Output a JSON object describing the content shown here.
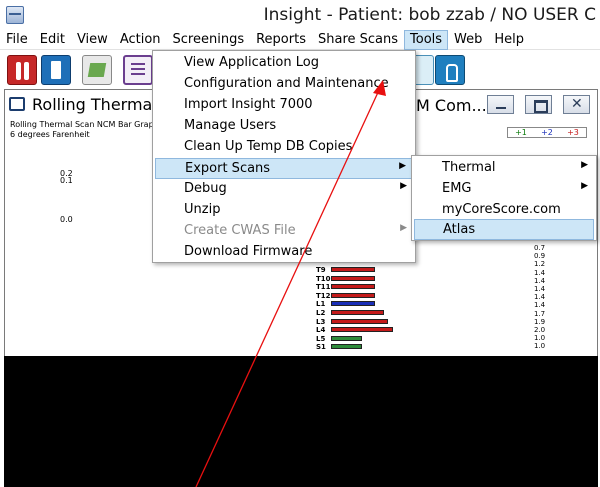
{
  "window": {
    "title": "Insight - Patient: bob zzab / NO USER C"
  },
  "menubar": [
    "File",
    "Edit",
    "View",
    "Action",
    "Screenings",
    "Reports",
    "Share Scans",
    "Tools",
    "Web",
    "Help"
  ],
  "toolbar": {
    "icons": [
      "scan-red-icon",
      "document-blue-icon",
      "scanner-green-icon",
      "list-icon",
      "scan-icon",
      "touch-icon"
    ]
  },
  "child_window": {
    "title_left": "Rolling Thermal",
    "title_right": "M Com...",
    "line1": "Rolling Thermal Scan NCM Bar Grap",
    "line2": "6 degrees Farenheit",
    "legend": [
      "+1",
      "+2",
      "+3"
    ]
  },
  "left_values": [
    "0.2",
    "0.1",
    "0.0"
  ],
  "vertebrae": [
    "T9",
    "T10",
    "T11",
    "T12",
    "L1",
    "L2",
    "L3",
    "L4",
    "L5",
    "S1"
  ],
  "right_values": [
    "0.7",
    "0.9",
    "1.2",
    "1.4",
    "1.4",
    "1.4",
    "1.4",
    "1.4",
    "1.7",
    "1.9",
    "2.0",
    "1.0",
    "1.0"
  ],
  "bar_chart": {
    "bars": [
      {
        "label": "T9",
        "color": "red",
        "value": 44
      },
      {
        "label": "T10",
        "color": "red",
        "value": 44
      },
      {
        "label": "T11",
        "color": "red",
        "value": 44
      },
      {
        "label": "T12",
        "color": "red",
        "value": 44
      },
      {
        "label": "L1",
        "color": "blue",
        "value": 44
      },
      {
        "label": "L2",
        "color": "red",
        "value": 53
      },
      {
        "label": "L3",
        "color": "red",
        "value": 57
      },
      {
        "label": "L4",
        "color": "red",
        "value": 62
      },
      {
        "label": "L5",
        "color": "green",
        "value": 31
      },
      {
        "label": "S1",
        "color": "green",
        "value": 31
      }
    ]
  },
  "tools_menu": {
    "items": [
      {
        "label": "View Application Log",
        "submenu": false,
        "disabled": false,
        "highlighted": false
      },
      {
        "label": "Configuration and Maintenance",
        "submenu": false,
        "disabled": false,
        "highlighted": false
      },
      {
        "label": "Import Insight 7000",
        "submenu": false,
        "disabled": false,
        "highlighted": false
      },
      {
        "label": "Manage Users",
        "submenu": false,
        "disabled": false,
        "highlighted": false
      },
      {
        "label": "Clean Up Temp DB Copies",
        "submenu": false,
        "disabled": false,
        "highlighted": false
      },
      {
        "label": "Export Scans",
        "submenu": true,
        "disabled": false,
        "highlighted": true
      },
      {
        "label": "Debug",
        "submenu": true,
        "disabled": false,
        "highlighted": false
      },
      {
        "label": "Unzip",
        "submenu": false,
        "disabled": false,
        "highlighted": false
      },
      {
        "label": "Create CWAS File",
        "submenu": true,
        "disabled": true,
        "highlighted": false
      },
      {
        "label": "Download Firmware",
        "submenu": false,
        "disabled": false,
        "highlighted": false
      }
    ]
  },
  "export_menu": {
    "items": [
      {
        "label": "Thermal",
        "submenu": true,
        "highlighted": false
      },
      {
        "label": "EMG",
        "submenu": true,
        "highlighted": false
      },
      {
        "label": "myCoreScore.com",
        "submenu": false,
        "highlighted": false
      },
      {
        "label": "Atlas",
        "submenu": false,
        "highlighted": true
      }
    ]
  },
  "annotation": {
    "color": "#e81010"
  }
}
